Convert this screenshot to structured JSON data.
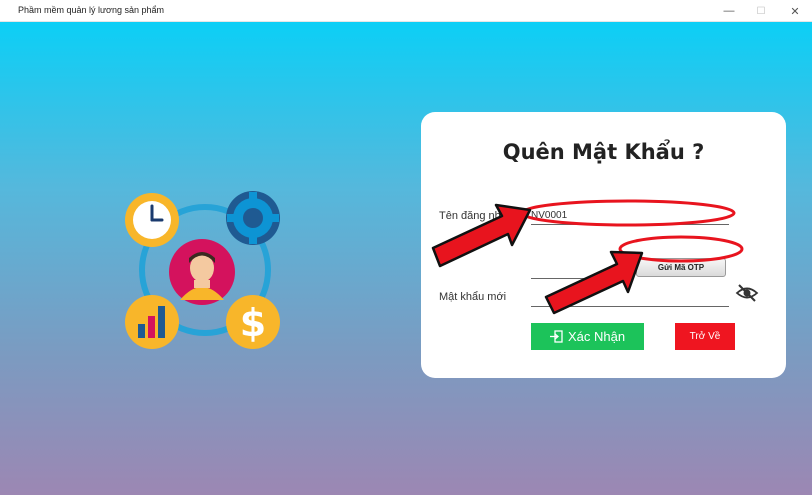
{
  "window": {
    "title": "Phầm mềm quản lý lương sản phẩm",
    "controls": {
      "minimize": "—",
      "maximize": "☐",
      "close": "✕"
    }
  },
  "illustration": {
    "icons": [
      "clock-icon",
      "gear-icon",
      "person-icon",
      "bar-chart-icon",
      "dollar-icon"
    ]
  },
  "form": {
    "title": "Quên Mật Khẩu ?",
    "username_label": "Tên đăng nhập",
    "username_value": "NV0001",
    "otp_value": "",
    "send_otp_label": "Gửi Mã OTP",
    "new_password_label": "Mật khẩu mới",
    "new_password_value": "",
    "confirm_label": "Xác Nhận",
    "back_label": "Trở Về"
  },
  "colors": {
    "background_top": "#0ccff6",
    "background_bottom": "#9c87b3",
    "confirm": "#1cc35a",
    "back": "#ef1520",
    "annotation": "#e8141e"
  }
}
